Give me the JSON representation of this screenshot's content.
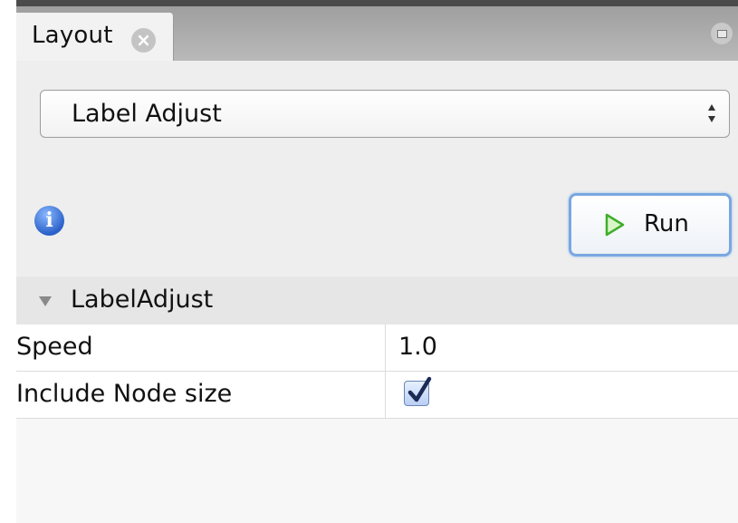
{
  "tab": {
    "title": "Layout",
    "close_icon": "close-icon",
    "maximize_icon": "maximize-icon"
  },
  "layout_selector": {
    "value": "Label Adjust",
    "arrows_icon": "up-down-arrows-icon"
  },
  "info_icon": "info-icon",
  "run_button": {
    "label": "Run",
    "icon": "play-icon"
  },
  "properties": {
    "group_title": "LabelAdjust",
    "rows": [
      {
        "name": "Speed",
        "value": "1.0"
      },
      {
        "name": "Include Node size",
        "checked": true
      }
    ]
  },
  "colors": {
    "accent": "#7aa7e0",
    "info_blue": "#2b62c9",
    "play_green": "#3fae2a"
  }
}
